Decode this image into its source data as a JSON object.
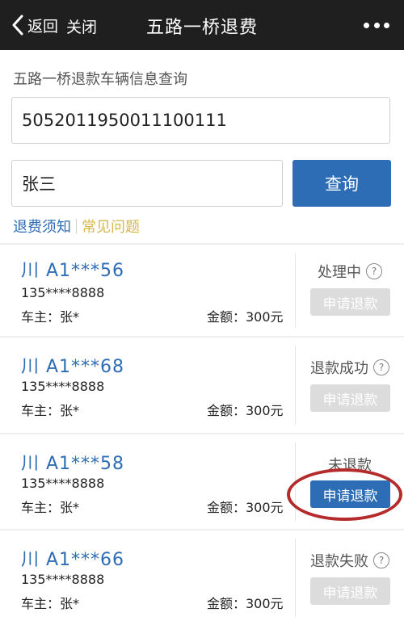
{
  "nav": {
    "back_label": "返回",
    "close_label": "关闭",
    "title": "五路一桥退费"
  },
  "query": {
    "section_title": "五路一桥退款车辆信息查询",
    "plate_value": "5052011950011100111",
    "name_value": "张三",
    "button_label": "查询"
  },
  "links": {
    "notice": "退费须知",
    "faq": "常见问题"
  },
  "records": [
    {
      "plate": "川 A1***56",
      "phone": "135****8888",
      "owner": "车主：张*",
      "amount": "金额：300元",
      "status": "处理中",
      "help": "?",
      "button": "申请退款",
      "enabled": false
    },
    {
      "plate": "川 A1***68",
      "phone": "135****8888",
      "owner": "车主：张*",
      "amount": "金额：300元",
      "status": "退款成功",
      "help": "?",
      "button": "申请退款",
      "enabled": false
    },
    {
      "plate": "川 A1***58",
      "phone": "135****8888",
      "owner": "车主：张*",
      "amount": "金额：300元",
      "status": "未退款",
      "help": "",
      "button": "申请退款",
      "enabled": true
    },
    {
      "plate": "川 A1***66",
      "phone": "135****8888",
      "owner": "车主：张*",
      "amount": "金额：300元",
      "status": "退款失败",
      "help": "?",
      "button": "申请退款",
      "enabled": false
    }
  ],
  "colors": {
    "accent": "#2d6db5",
    "faq": "#d7b74a",
    "topbar": "#1f1f1f",
    "disabled_button": "#dcdcdc",
    "annotation": "#b52a2a"
  }
}
